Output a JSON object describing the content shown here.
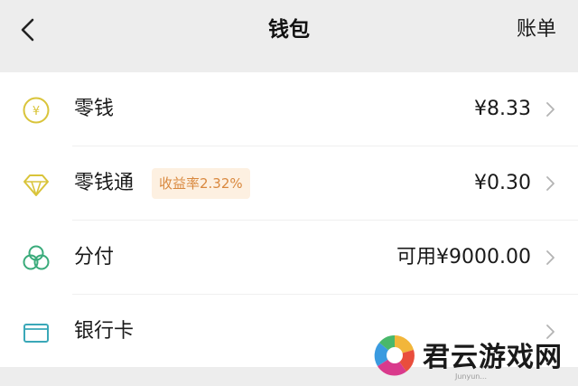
{
  "header": {
    "title": "钱包",
    "action_label": "账单",
    "back_icon": "chevron-left-icon"
  },
  "items": [
    {
      "label": "零钱",
      "value": "¥8.33",
      "icon": "yuan-coin-icon",
      "icon_color": "#d9c43a"
    },
    {
      "label": "零钱通",
      "badge": "收益率2.32%",
      "value": "¥0.30",
      "icon": "diamond-icon",
      "icon_color": "#d9c43a"
    },
    {
      "label": "分付",
      "value": "可用¥9000.00",
      "icon": "fenfu-circles-icon",
      "icon_color": "#3aab7b"
    },
    {
      "label": "银行卡",
      "icon": "bank-card-icon",
      "icon_color": "#3aa8b8"
    }
  ],
  "watermark": {
    "name": "君云游戏网",
    "sub": "Junyun..."
  },
  "colors": {
    "background": "#ededed",
    "list_background": "#ffffff",
    "badge_text": "#d9883e",
    "badge_background": "#fdf0e1"
  }
}
